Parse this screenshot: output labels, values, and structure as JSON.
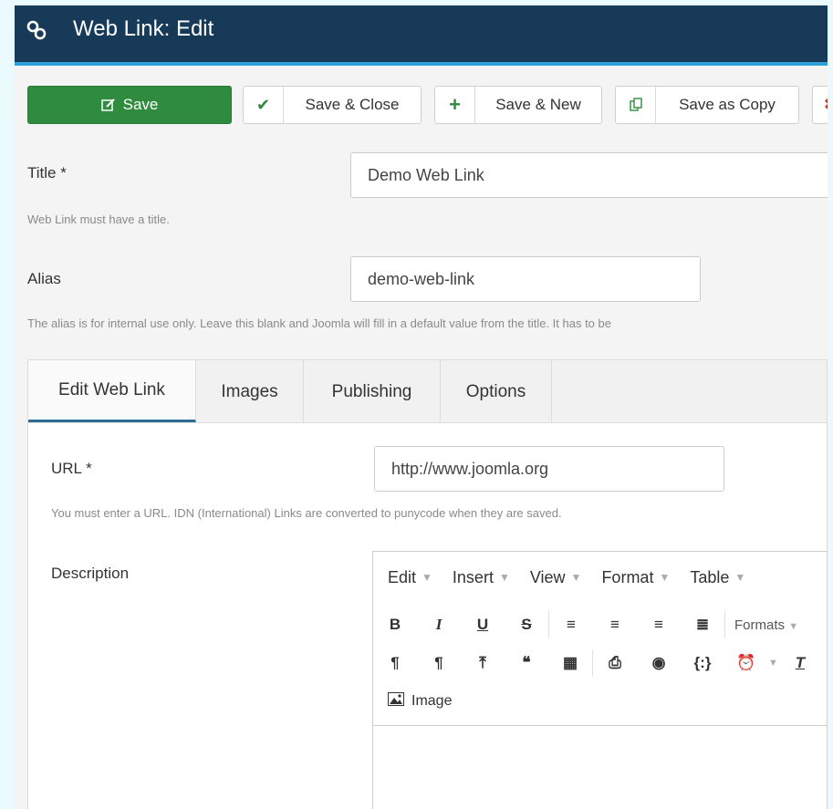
{
  "header": {
    "title": "Web Link: Edit",
    "icon": "link-icon"
  },
  "toolbar": {
    "save_label": "Save",
    "save_close_label": "Save & Close",
    "save_new_label": "Save & New",
    "save_copy_label": "Save as Copy"
  },
  "form": {
    "title_label": "Title *",
    "title_value": "Demo Web Link",
    "title_help": "Web Link must have a title.",
    "alias_label": "Alias",
    "alias_value": "demo-web-link",
    "alias_help": "The alias is for internal use only. Leave this blank and Joomla will fill in a default value from the title. It has to be"
  },
  "tabs": [
    "Edit Web Link",
    "Images",
    "Publishing",
    "Options"
  ],
  "panel": {
    "url_label": "URL *",
    "url_value": "http://www.joomla.org",
    "url_help": "You must enter a URL. IDN (International) Links are converted to punycode when they are saved.",
    "description_label": "Description"
  },
  "editor": {
    "menus": [
      "Edit",
      "Insert",
      "View",
      "Format",
      "Table"
    ],
    "formats_label": "Formats",
    "image_label": "Image"
  },
  "colors": {
    "header_bg": "#173a58",
    "accent": "#2e9fd8",
    "save_green": "#2f8c3e",
    "tab_active": "#2c6e94"
  }
}
